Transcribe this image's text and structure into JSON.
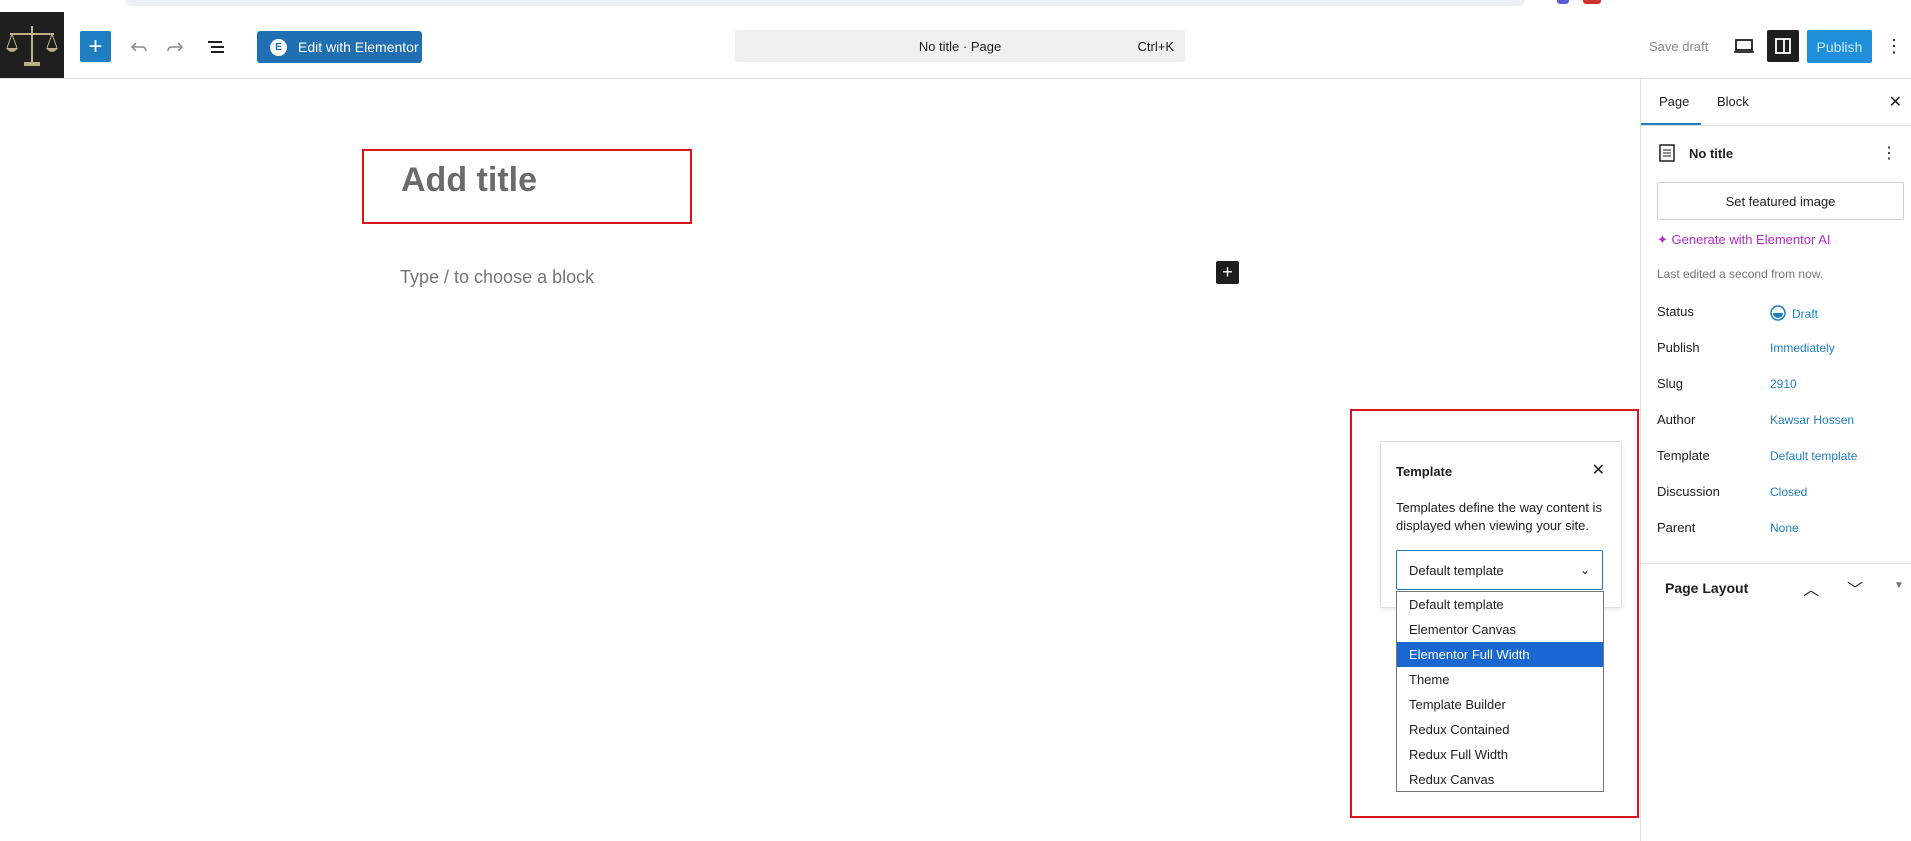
{
  "toolbar": {
    "edit_with_elementor": "Edit with Elementor",
    "command_title": "No title · Page",
    "command_shortcut": "Ctrl+K",
    "save_draft": "Save draft",
    "publish": "Publish"
  },
  "editor": {
    "title_placeholder": "Add title",
    "block_hint": "Type / to choose a block"
  },
  "template_popover": {
    "heading": "Template",
    "description": "Templates define the way content is displayed when viewing your site.",
    "selected": "Default template",
    "options": [
      "Default template",
      "Elementor Canvas",
      "Elementor Full Width",
      "Theme",
      "Template Builder",
      "Redux Contained",
      "Redux Full Width",
      "Redux Canvas"
    ],
    "highlighted_option": "Elementor Full Width"
  },
  "sidebar": {
    "tabs": [
      "Page",
      "Block"
    ],
    "doc_title": "No title",
    "featured_image": "Set featured image",
    "ai_link": "Generate with Elementor AI",
    "last_edited": "Last edited a second from now.",
    "rows": [
      {
        "label": "Status",
        "value": "Draft"
      },
      {
        "label": "Publish",
        "value": "Immediately"
      },
      {
        "label": "Slug",
        "value": "2910"
      },
      {
        "label": "Author",
        "value": "Kawsar Hossen"
      },
      {
        "label": "Template",
        "value": "Default template"
      },
      {
        "label": "Discussion",
        "value": "Closed"
      },
      {
        "label": "Parent",
        "value": "None"
      }
    ],
    "page_layout": "Page Layout"
  },
  "colors": {
    "accent": "#1e7ec0",
    "highlight_border": "#d9141c",
    "ai_purple": "#b02cc6",
    "selected_option": "#1967d2"
  }
}
